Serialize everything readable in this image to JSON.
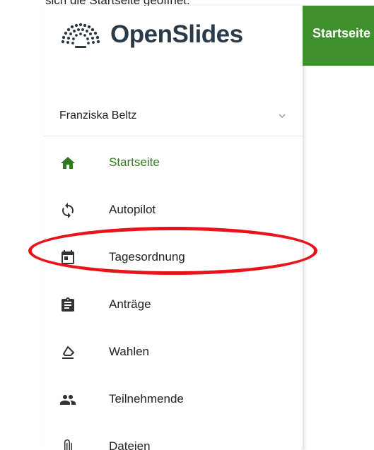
{
  "page": {
    "caption": "sich die Startseite geöffnet."
  },
  "sidebar": {
    "app_name": "OpenSlides",
    "user": {
      "name": "Franziska Beltz"
    },
    "items": [
      {
        "label": "Startseite",
        "icon": "home-icon",
        "active": true
      },
      {
        "label": "Autopilot",
        "icon": "sync-icon",
        "active": false
      },
      {
        "label": "Tagesordnung",
        "icon": "calendar-icon",
        "active": false
      },
      {
        "label": "Anträge",
        "icon": "clipboard-icon",
        "active": false
      },
      {
        "label": "Wahlen",
        "icon": "ballot-icon",
        "active": false
      },
      {
        "label": "Teilnehmende",
        "icon": "people-icon",
        "active": false
      },
      {
        "label": "Dateien",
        "icon": "paperclip-icon",
        "active": false
      }
    ]
  },
  "header": {
    "title": "Startseite"
  },
  "colors": {
    "brand_green": "#3f8f2c",
    "active_green": "#317a1f",
    "annotation_red": "#e8141b",
    "logo_text": "#2b3a49"
  }
}
